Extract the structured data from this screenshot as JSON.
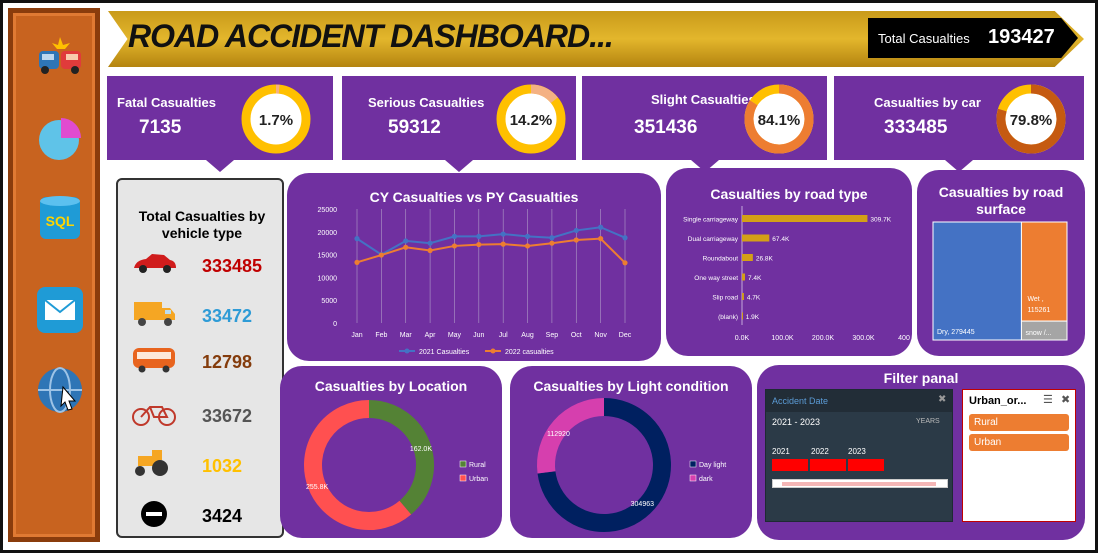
{
  "title": "ROAD ACCIDENT DASHBOARD...",
  "total": {
    "label": "Total Casualties",
    "value": "193427"
  },
  "kpis": [
    {
      "label": "Fatal Casualties",
      "value": "7135",
      "pct": "1.7%",
      "fraction": 0.017,
      "color": "#ffc000"
    },
    {
      "label": "Serious Casualties",
      "value": "59312",
      "pct": "14.2%",
      "fraction": 0.142,
      "color": "#ffc000"
    },
    {
      "label": "Slight Casualties",
      "value": "351436",
      "pct": "84.1%",
      "fraction": 0.841,
      "color": "#ed7d31"
    },
    {
      "label": "Casualties by car",
      "value": "333485",
      "pct": "79.8%",
      "fraction": 0.798,
      "color": "#c55a11"
    }
  ],
  "vehicle": {
    "title": "Total Casualties by vehicle type",
    "rows": [
      {
        "icon": "car-icon",
        "value": "333485",
        "color": "#c00000"
      },
      {
        "icon": "van-icon",
        "value": "33472",
        "color": "#2e9bd6"
      },
      {
        "icon": "bus-icon",
        "value": "12798",
        "color": "#843c0c"
      },
      {
        "icon": "bicycle-icon",
        "value": "33672",
        "color": "#555555"
      },
      {
        "icon": "tractor-icon",
        "value": "1032",
        "color": "#ffc000"
      },
      {
        "icon": "other-icon",
        "value": "3424",
        "color": "#000000"
      }
    ]
  },
  "panels": {
    "line_title": "CY Casualties vs PY Casualties",
    "road_title": "Casualties by road type",
    "surface_title": "Casualties by road surface",
    "location_title": "Casualties by Location",
    "light_title": "Casualties by Light condition",
    "filter_title": "Filter panal"
  },
  "filter": {
    "date_title": "Accident Date",
    "range": "2021 - 2023",
    "unit": "YEARS",
    "years": [
      "2021",
      "2022",
      "2023"
    ],
    "area_title": "Urban_or...",
    "areas": [
      "Rural",
      "Urban"
    ]
  },
  "chart_data": [
    {
      "type": "line",
      "title": "CY Casualties vs PY Casualties",
      "categories": [
        "Jan",
        "Feb",
        "Mar",
        "Apr",
        "May",
        "Jun",
        "Jul",
        "Aug",
        "Sep",
        "Oct",
        "Nov",
        "Dec"
      ],
      "series": [
        {
          "name": "2021 Casualties",
          "color": "#4472c4",
          "values": [
            18500,
            15000,
            18000,
            17500,
            19000,
            19000,
            19500,
            19000,
            18700,
            20300,
            21000,
            18700
          ]
        },
        {
          "name": "2022 casualties",
          "color": "#ed7d31",
          "values": [
            13300,
            14900,
            16600,
            15900,
            16900,
            17200,
            17300,
            16900,
            17500,
            18200,
            18500,
            13200
          ]
        }
      ],
      "yticks": [
        "0",
        "5000",
        "10000",
        "15000",
        "20000",
        "25000"
      ],
      "ylim": [
        0,
        25000
      ]
    },
    {
      "type": "bar",
      "title": "Casualties by road type",
      "categories": [
        "Single carriageway",
        "Dual carriageway",
        "Roundabout",
        "One way street",
        "Slip road",
        "(blank)"
      ],
      "values": [
        309.7,
        67.4,
        26.8,
        7.4,
        4.7,
        1.9
      ],
      "labels": [
        "309.7K",
        "67.4K",
        "26.8K",
        "7.4K",
        "4.7K",
        "1.9K"
      ],
      "xticks": [
        "0.0K",
        "100.0K",
        "200.0K",
        "300.0K",
        "400"
      ],
      "xlim": [
        0,
        400
      ]
    },
    {
      "type": "treemap",
      "title": "Casualties by road surface",
      "items": [
        {
          "label": "Dry, 279445",
          "value": 279445,
          "color": "#4472c4"
        },
        {
          "label": "Wet , 115261",
          "value": 115261,
          "color": "#ed7d31"
        },
        {
          "label": "snow /...",
          "value": 20000,
          "color": "#a5a5a5"
        }
      ]
    },
    {
      "type": "pie",
      "title": "Casualties by Location",
      "slices": [
        {
          "name": "Rural",
          "value": 162.0,
          "label": "162.0K",
          "color": "#548235"
        },
        {
          "name": "Urban",
          "value": 255.8,
          "label": "255.8K",
          "color": "#ff5050"
        }
      ]
    },
    {
      "type": "pie",
      "title": "Casualties by Light condition",
      "slices": [
        {
          "name": "Day light",
          "value": 304963,
          "label": "304963",
          "color": "#002060"
        },
        {
          "name": "dark",
          "value": 112920,
          "label": "112920",
          "color": "#d63fae"
        }
      ]
    }
  ]
}
